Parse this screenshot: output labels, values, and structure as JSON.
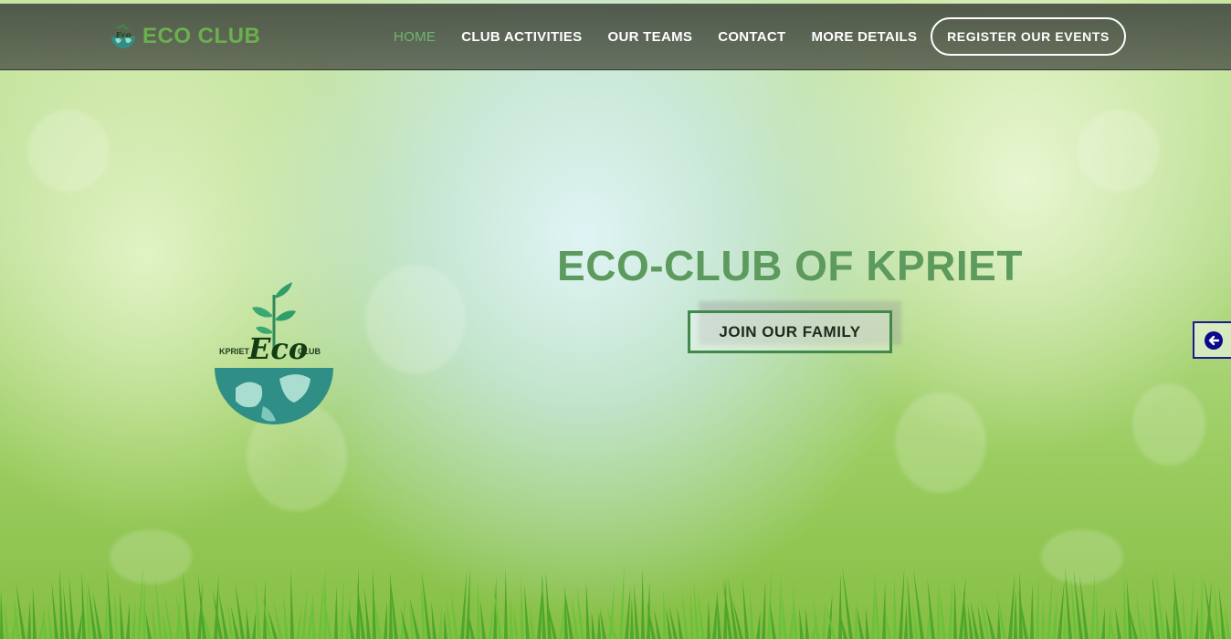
{
  "brand": {
    "name": "ECO CLUB",
    "icon": "eco-globe-logo-icon"
  },
  "nav": {
    "items": [
      {
        "label": "HOME",
        "active": true
      },
      {
        "label": "CLUB ACTIVITIES",
        "active": false
      },
      {
        "label": "OUR TEAMS",
        "active": false
      },
      {
        "label": "CONTACT",
        "active": false
      },
      {
        "label": "MORE DETAILS",
        "active": false
      }
    ],
    "register_label": "REGISTER OUR EVENTS"
  },
  "hero": {
    "title": "ECO-CLUB OF KPRIET",
    "cta_label": "JOIN OUR FAMILY",
    "logo": {
      "left_text": "KPRIET",
      "center_text": "Eco",
      "right_text": "CLUB"
    }
  },
  "side_toggle": {
    "icon": "arrow-left-circle-icon"
  },
  "colors": {
    "accent_green": "#5c9a5d",
    "brand_green": "#6bb04d",
    "toggle_blue": "#1a1a8c"
  }
}
